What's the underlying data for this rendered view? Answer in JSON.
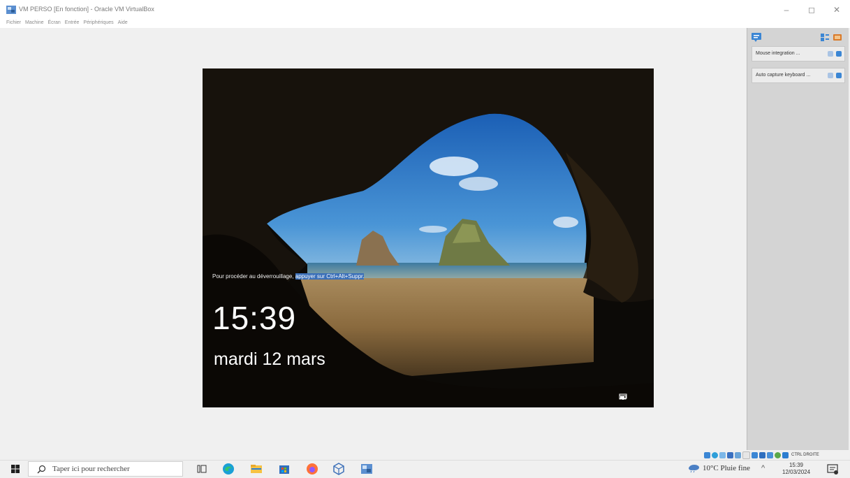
{
  "window": {
    "title": "VM PERSO [En fonction] - Oracle VM VirtualBox",
    "minimize_glyph": "–",
    "maximize_glyph": "◻",
    "close_glyph": "✕"
  },
  "menu": {
    "items": [
      "Fichier",
      "Machine",
      "Écran",
      "Entrée",
      "Périphériques",
      "Aide"
    ]
  },
  "lockscreen": {
    "hint_prefix": "Pour procéder au déverrouillage, ",
    "hint_highlight": "appuyer sur Ctrl+Alt+Suppr.",
    "time": "15:39",
    "date": "mardi 12 mars",
    "icons": [
      "network-icon",
      "battery-icon"
    ]
  },
  "side_panel": {
    "notifications": [
      {
        "label": "Mouse integration ..."
      },
      {
        "label": "Auto capture keyboard ..."
      }
    ]
  },
  "vbox_status": {
    "host_key": "CTRL DROITE"
  },
  "taskbar": {
    "search_placeholder": "Taper ici pour rechercher",
    "apps": [
      "task-view-icon",
      "edge-icon",
      "file-explorer-icon",
      "store-icon",
      "firefox-icon",
      "virtualbox-extension-icon",
      "virtualbox-icon"
    ],
    "weather": "10°C Pluie fine",
    "chevron": "^",
    "clock_time": "15:39",
    "clock_date": "12/03/2024"
  },
  "colors": {
    "accent": "#0078d7",
    "highlight": "#3a6fb8",
    "panel_bg": "#d4d4d4"
  }
}
